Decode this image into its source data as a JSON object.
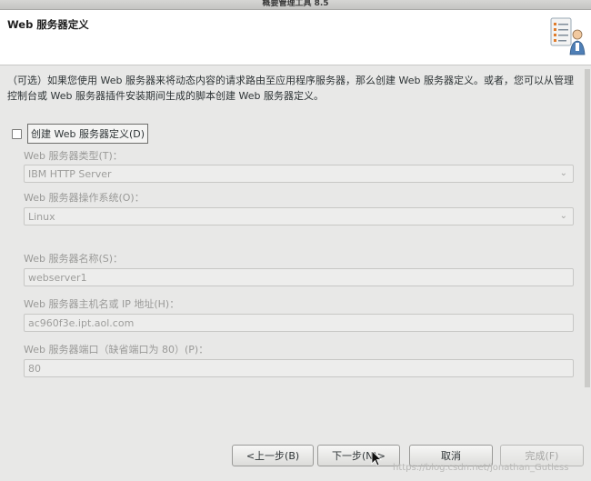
{
  "window": {
    "title": "概要管理工具 8.5"
  },
  "header": {
    "title": "Web 服务器定义",
    "icon": "wizard-checklist-person-icon"
  },
  "description": "（可选）如果您使用 Web 服务器来将动态内容的请求路由至应用程序服务器，那么创建 Web 服务器定义。或者，您可以从管理控制台或 Web 服务器插件安装期间生成的脚本创建 Web 服务器定义。",
  "create_checkbox": {
    "label": "创建 Web 服务器定义(D)",
    "checked": false
  },
  "fields": {
    "type": {
      "label": "Web 服务器类型(T)：",
      "value": "IBM HTTP Server"
    },
    "os": {
      "label": "Web 服务器操作系统(O)：",
      "value": "Linux"
    },
    "name": {
      "label": "Web 服务器名称(S)：",
      "value": "webserver1"
    },
    "host": {
      "label": "Web 服务器主机名或 IP 地址(H)：",
      "value": "ac960f3e.ipt.aol.com"
    },
    "port": {
      "label": "Web 服务器端口（缺省端口为 80）(P)：",
      "value": "80"
    }
  },
  "buttons": {
    "back": "<上一步(B)",
    "next": "下一步(N)>",
    "cancel": "取消",
    "finish": "完成(F)"
  },
  "watermark": "https://blog.csdn.net/jonathan_Gutless"
}
